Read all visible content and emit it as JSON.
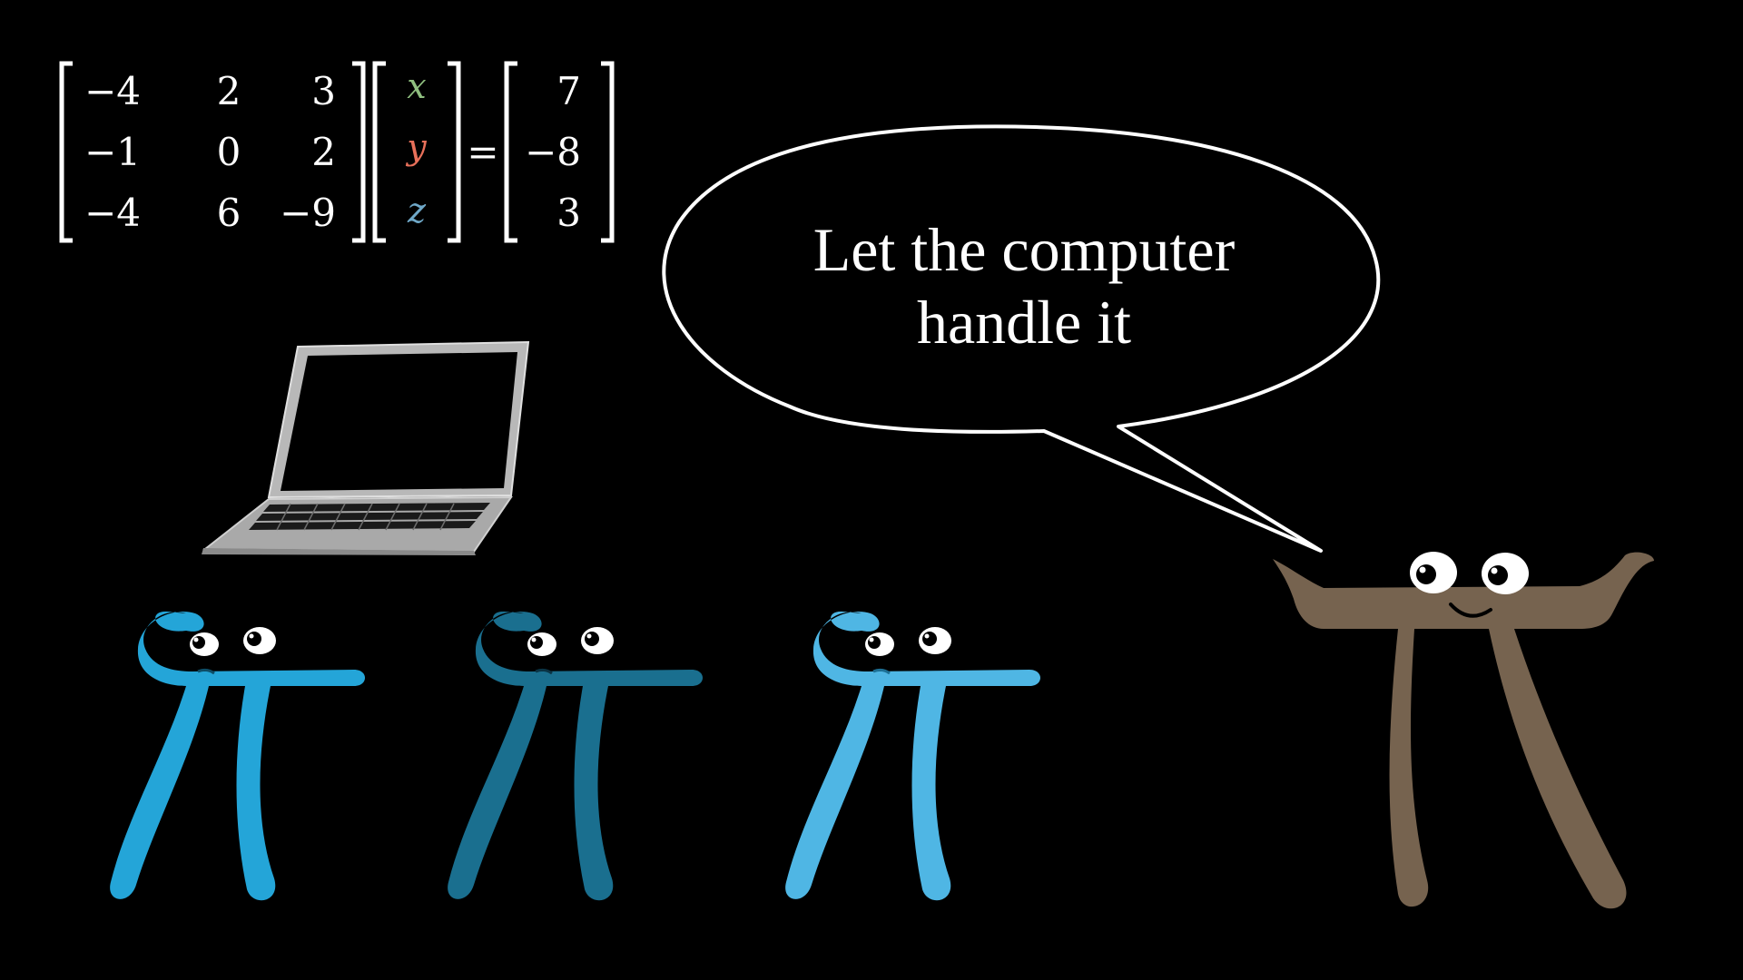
{
  "equation": {
    "matrix": [
      [
        "−4",
        "2",
        "3"
      ],
      [
        "−1",
        "0",
        "2"
      ],
      [
        "−4",
        "6",
        "−9"
      ]
    ],
    "variables": [
      {
        "symbol": "x",
        "color": "#8fbf7f"
      },
      {
        "symbol": "y",
        "color": "#e8705a"
      },
      {
        "symbol": "z",
        "color": "#6fa8c8"
      }
    ],
    "equals": "=",
    "result": [
      "7",
      "−8",
      "3"
    ],
    "result_color": "#f5e33c"
  },
  "speech_bubble": {
    "line1": "Let the computer",
    "line2": "handle it"
  },
  "characters": [
    {
      "name": "blue-pi",
      "color": "#24a5d8"
    },
    {
      "name": "dark-blue-pi",
      "color": "#1a6f8f"
    },
    {
      "name": "light-blue-pi",
      "color": "#4fb6e4"
    },
    {
      "name": "brown-pi",
      "color": "#76634f"
    }
  ]
}
